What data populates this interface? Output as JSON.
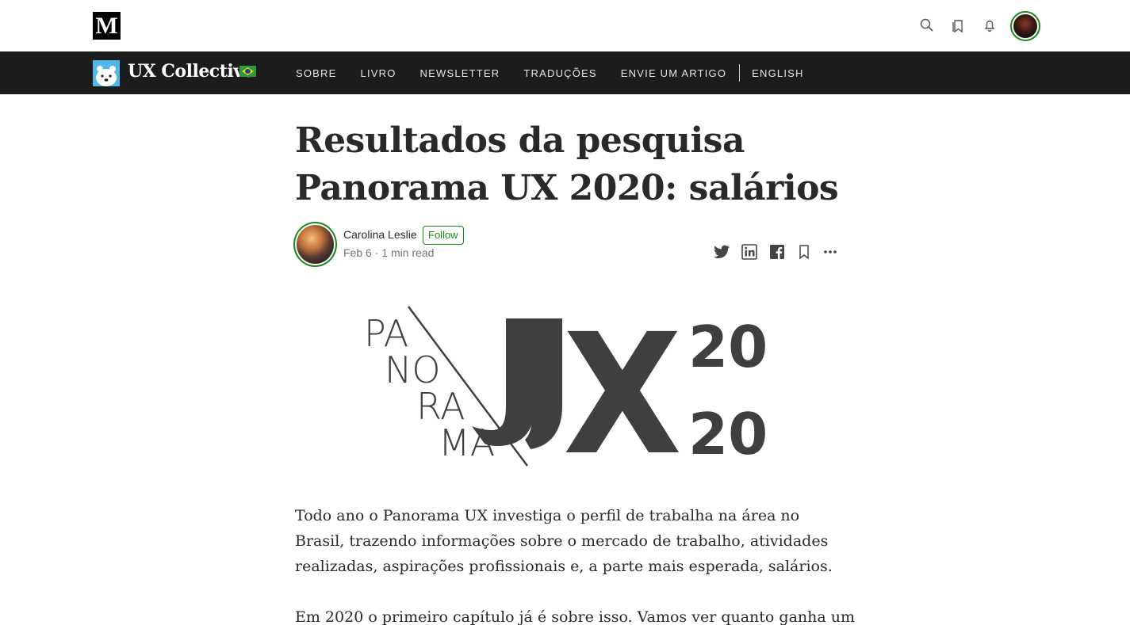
{
  "topbar": {
    "logo": "M",
    "icons": [
      "search-icon",
      "bookmarks-icon",
      "notifications-icon"
    ],
    "avatar": "user-avatar"
  },
  "publication": {
    "name": "UX Collective",
    "flag": "brazil-flag",
    "nav": [
      "SOBRE",
      "LIVRO",
      "NEWSLETTER",
      "TRADUÇÕES",
      "ENVIE UM ARTIGO"
    ],
    "language_link": "ENGLISH"
  },
  "article": {
    "title_line1": "Resultados da pesquisa",
    "title_line2": "Panorama UX 2020: salários",
    "author": "Carolina Leslie",
    "follow_label": "Follow",
    "date": "Feb 6",
    "read_time": "1 min read",
    "share_icons": [
      "twitter-icon",
      "linkedin-icon",
      "facebook-icon",
      "bookmark-icon",
      "more-icon"
    ],
    "hero": {
      "left_words": [
        "PA",
        "NO",
        "RA",
        "MA"
      ],
      "big": "UX",
      "year_top": "20",
      "year_bottom": "20"
    },
    "paragraph1": "Todo ano o Panorama UX investiga o perfil de trabalha na área no Brasil, trazendo informações sobre o mercado de trabalho, atividades realizadas, aspirações profissionais e, a parte mais esperada, salários.",
    "paragraph2": "Em 2020 o primeiro capítulo já é sobre isso. Vamos ver quanto ganha um"
  },
  "colors": {
    "accent_green": "#1a8917",
    "pub_bar": "#1c1c1c",
    "hero_gray": "#3f3f3f"
  }
}
